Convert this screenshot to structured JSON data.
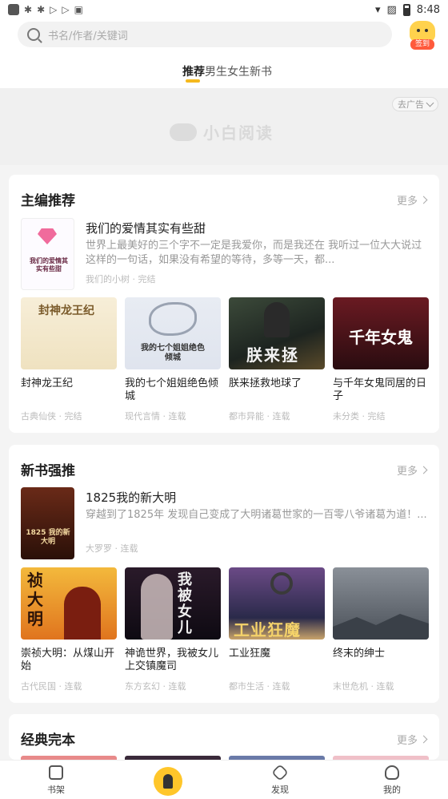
{
  "status_bar": {
    "time": "8:48"
  },
  "search": {
    "placeholder": "书名/作者/关键词"
  },
  "signin": {
    "label": "签到"
  },
  "tabs": [
    {
      "label": "推荐",
      "active": true
    },
    {
      "label": "男生",
      "active": false
    },
    {
      "label": "女生",
      "active": false
    },
    {
      "label": "新书",
      "active": false
    }
  ],
  "banner": {
    "ad_label": "去广告",
    "logo_text": "小白阅读"
  },
  "sections": [
    {
      "title": "主编推荐",
      "more": "更多",
      "featured": {
        "title": "我们的爱情其实有些甜",
        "desc": "世界上最美好的三个字不一定是我爱你，而是我还在 我听过一位大大说过这样的一句话，如果没有希望的等待，多等一天，都...",
        "meta": "我们的小树 · 完结",
        "cover_text": "我们的爱情其实有些甜"
      },
      "books": [
        {
          "title": "封神龙王纪",
          "meta": "古典仙侠 · 完结",
          "cover_text": "封神龙王纪"
        },
        {
          "title": "我的七个姐姐绝色倾城",
          "meta": "现代言情 · 连载",
          "cover_text": "我的七个姐姐绝色倾城"
        },
        {
          "title": "朕来拯救地球了",
          "meta": "都市异能 · 连载",
          "cover_text": "朕来拯"
        },
        {
          "title": "与千年女鬼同居的日子",
          "meta": "未分类 · 完结",
          "cover_text": "千年女鬼"
        }
      ]
    },
    {
      "title": "新书强推",
      "more": "更多",
      "featured": {
        "title": "1825我的新大明",
        "desc": "穿越到了1825年 发现自己变成了大明诸葛世家的一百零八爷诸葛为道！...",
        "meta": "大罗罗 · 连载",
        "cover_text": "1825 我的新大明"
      },
      "books": [
        {
          "title": "崇祯大明：从煤山开始",
          "meta": "古代民国 · 连载",
          "cover_text": "祯大明"
        },
        {
          "title": "神诡世界，我被女儿上交镇魔司",
          "meta": "东方玄幻 · 连载",
          "cover_text": "我被女儿"
        },
        {
          "title": "工业狂魔",
          "meta": "都市生活 · 连载",
          "cover_text": "工业狂魔"
        },
        {
          "title": "终末的绅士",
          "meta": "末世危机 · 连载",
          "cover_text": ""
        }
      ]
    },
    {
      "title": "经典完本",
      "more": "更多"
    }
  ],
  "bottom_nav": [
    {
      "label": "书架",
      "icon": "bookshelf-icon"
    },
    {
      "label": "",
      "icon": "rocket-icon"
    },
    {
      "label": "发现",
      "icon": "discover-icon"
    },
    {
      "label": "我的",
      "icon": "profile-icon"
    }
  ],
  "colors": {
    "accent": "#f5b91e",
    "center_button": "#ffc62a"
  }
}
